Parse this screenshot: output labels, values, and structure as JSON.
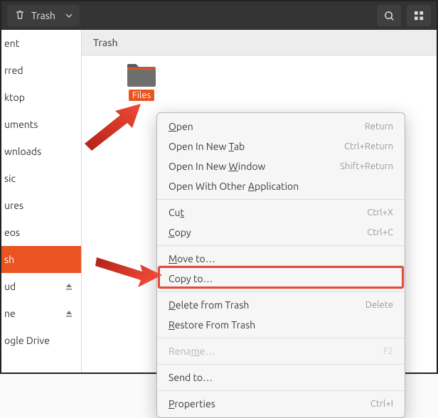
{
  "topbar": {
    "location_label": "Trash"
  },
  "sidebar": {
    "items": [
      {
        "label": "ent",
        "eject": false
      },
      {
        "label": "rred",
        "eject": false
      },
      {
        "label": "ktop",
        "eject": false
      },
      {
        "label": "uments",
        "eject": false
      },
      {
        "label": "wnloads",
        "eject": false
      },
      {
        "label": "sic",
        "eject": false
      },
      {
        "label": "ures",
        "eject": false
      },
      {
        "label": "eos",
        "eject": false
      },
      {
        "label": "sh",
        "eject": false,
        "active": true
      },
      {
        "label": "ud",
        "eject": true
      },
      {
        "label": "ne",
        "eject": true
      },
      {
        "label": "ogle Drive",
        "eject": false
      }
    ]
  },
  "content": {
    "title": "Trash",
    "selected_folder": "Files"
  },
  "context_menu": {
    "groups": [
      [
        {
          "label_pre": "",
          "mn": "O",
          "label_post": "pen",
          "shortcut": "Return",
          "disabled": false
        },
        {
          "label_pre": "Open In New ",
          "mn": "T",
          "label_post": "ab",
          "shortcut": "Ctrl+Return",
          "disabled": false
        },
        {
          "label_pre": "Open In New ",
          "mn": "W",
          "label_post": "indow",
          "shortcut": "Shift+Return",
          "disabled": false
        },
        {
          "label_pre": "Open With Other ",
          "mn": "A",
          "label_post": "pplication",
          "shortcut": "",
          "disabled": false
        }
      ],
      [
        {
          "label_pre": "Cu",
          "mn": "t",
          "label_post": "",
          "shortcut": "Ctrl+X",
          "disabled": false
        },
        {
          "label_pre": "",
          "mn": "C",
          "label_post": "opy",
          "shortcut": "Ctrl+C",
          "disabled": false
        }
      ],
      [
        {
          "label_pre": "",
          "mn": "M",
          "label_post": "ove to…",
          "shortcut": "",
          "disabled": false
        },
        {
          "label_pre": "Copy to…",
          "mn": "",
          "label_post": "",
          "shortcut": "",
          "disabled": false
        }
      ],
      [
        {
          "label_pre": "",
          "mn": "D",
          "label_post": "elete from Trash",
          "shortcut": "Delete",
          "disabled": false
        },
        {
          "label_pre": "",
          "mn": "R",
          "label_post": "estore From Trash",
          "shortcut": "",
          "disabled": false
        }
      ],
      [
        {
          "label_pre": "Rena",
          "mn": "m",
          "label_post": "e…",
          "shortcut": "F2",
          "disabled": true
        }
      ],
      [
        {
          "label_pre": "Send to…",
          "mn": "",
          "label_post": "",
          "shortcut": "",
          "disabled": false
        }
      ],
      [
        {
          "label_pre": "",
          "mn": "P",
          "label_post": "roperties",
          "shortcut": "Ctrl+I",
          "disabled": false
        }
      ]
    ]
  }
}
